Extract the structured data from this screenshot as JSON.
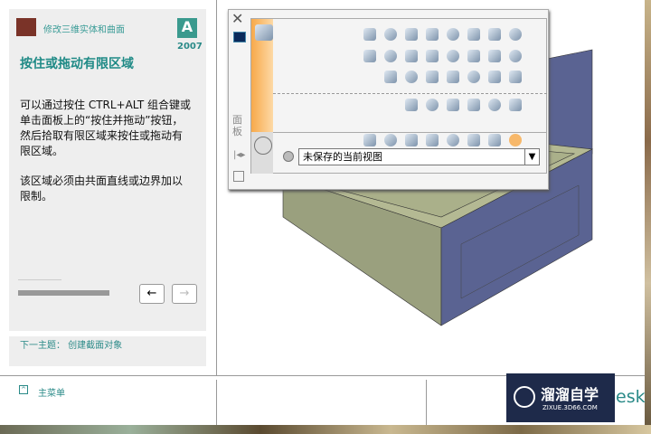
{
  "tutorial": {
    "breadcrumb": "修改三维实体和曲面",
    "version": "2007",
    "title": "按住或拖动有限区域",
    "para1": [
      "可以通过按住 CTRL+ALT 组合键或",
      "单击面板上的“按住并拖动”按钮，",
      "然后拾取有限区域来按住或拖动有",
      "限区域。"
    ],
    "para2": [
      "该区域必须由共面直线或边界加以",
      "限制。"
    ],
    "back_label": "←",
    "forward_label": "→",
    "next_topic": "下一主题：  创建截面对象",
    "main_menu": "主菜单"
  },
  "dashboard": {
    "close_label": "✕",
    "side_tab": "面板",
    "view_dropdown": "未保存的当前视图"
  },
  "watermark": {
    "title": "溜溜自学",
    "url": "ZIXUE.3D66.COM",
    "partial": "esk"
  },
  "colors": {
    "accent": "#1f8a86",
    "orange": "#f7a94a",
    "face_olive": "#9aa07e",
    "face_blue": "#5a6392"
  }
}
